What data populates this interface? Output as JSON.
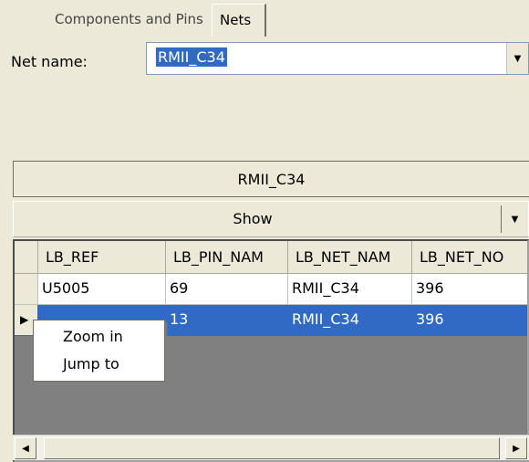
{
  "tabs": [
    {
      "label": "Components and Pins",
      "active": false
    },
    {
      "label": "Nets",
      "active": true
    }
  ],
  "net_name": {
    "label": "Net name:",
    "value": "RMII_C34"
  },
  "net_title": "RMII_C34",
  "show": {
    "label": "Show"
  },
  "table": {
    "columns": [
      "LB_REF",
      "LB_PIN_NAM",
      "LB_NET_NAM",
      "LB_NET_NO"
    ],
    "rows": [
      {
        "ref": "U5005",
        "pin": "69",
        "net": "RMII_C34",
        "no": "396",
        "selected": false
      },
      {
        "ref": "",
        "pin": "13",
        "net": "RMII_C34",
        "no": "396",
        "selected": true
      }
    ]
  },
  "context_menu": [
    "Zoom in",
    "Jump to"
  ],
  "icons": {
    "combo_dropdown": "chevron-down-icon",
    "show_dropdown": "chevron-down-icon",
    "row_marker": "triangle-right-icon",
    "scroll_left": "triangle-left-icon",
    "scroll_right": "triangle-right-icon"
  },
  "colors": {
    "selection": "#316ac5",
    "grid_empty": "#808080",
    "panel": "#ece9d8"
  }
}
